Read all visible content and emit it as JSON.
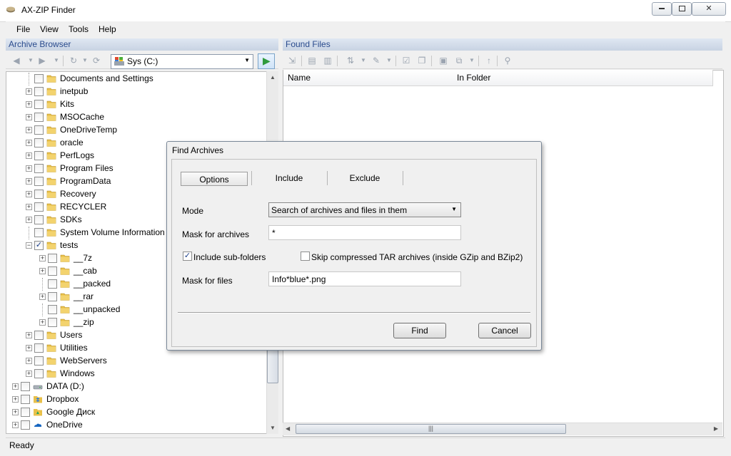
{
  "window": {
    "title": "AX-ZIP Finder",
    "buttons": [
      "▭",
      "□",
      "✕"
    ]
  },
  "menu": [
    "File",
    "View",
    "Tools",
    "Help"
  ],
  "left_pane": {
    "title": "Archive Browser",
    "drive_selected": "Sys (C:)",
    "tree": [
      {
        "label": "Documents and Settings",
        "level": 1,
        "expander": false,
        "checked": false
      },
      {
        "label": "inetpub",
        "level": 1,
        "expander": true,
        "checked": false
      },
      {
        "label": "Kits",
        "level": 1,
        "expander": true,
        "checked": false
      },
      {
        "label": "MSOCache",
        "level": 1,
        "expander": true,
        "checked": false
      },
      {
        "label": "OneDriveTemp",
        "level": 1,
        "expander": true,
        "checked": false
      },
      {
        "label": "oracle",
        "level": 1,
        "expander": true,
        "checked": false
      },
      {
        "label": "PerfLogs",
        "level": 1,
        "expander": true,
        "checked": false
      },
      {
        "label": "Program Files",
        "level": 1,
        "expander": true,
        "checked": false
      },
      {
        "label": "ProgramData",
        "level": 1,
        "expander": true,
        "checked": false
      },
      {
        "label": "Recovery",
        "level": 1,
        "expander": true,
        "checked": false
      },
      {
        "label": "RECYCLER",
        "level": 1,
        "expander": true,
        "checked": false
      },
      {
        "label": "SDKs",
        "level": 1,
        "expander": true,
        "checked": false
      },
      {
        "label": "System Volume Information",
        "level": 1,
        "expander": false,
        "checked": false
      },
      {
        "label": "tests",
        "level": 1,
        "expander": "open",
        "checked": true
      },
      {
        "label": "__7z",
        "level": 2,
        "expander": true,
        "checked": false
      },
      {
        "label": "__cab",
        "level": 2,
        "expander": true,
        "checked": false
      },
      {
        "label": "__packed",
        "level": 2,
        "expander": false,
        "checked": false
      },
      {
        "label": "__rar",
        "level": 2,
        "expander": true,
        "checked": false
      },
      {
        "label": "__unpacked",
        "level": 2,
        "expander": false,
        "checked": false
      },
      {
        "label": "__zip",
        "level": 2,
        "expander": true,
        "checked": false
      },
      {
        "label": "Users",
        "level": 1,
        "expander": true,
        "checked": false
      },
      {
        "label": "Utilities",
        "level": 1,
        "expander": true,
        "checked": false
      },
      {
        "label": "WebServers",
        "level": 1,
        "expander": true,
        "checked": false
      },
      {
        "label": "Windows",
        "level": 1,
        "expander": true,
        "checked": false
      },
      {
        "label": "DATA (D:)",
        "level": 0,
        "expander": true,
        "checked": false,
        "icon": "drive-icon"
      },
      {
        "label": "Dropbox",
        "level": 0,
        "expander": true,
        "checked": false,
        "icon": "dropbox-icon"
      },
      {
        "label": "Google Диск",
        "level": 0,
        "expander": true,
        "checked": false,
        "icon": "google-drive-icon"
      },
      {
        "label": "OneDrive",
        "level": 0,
        "expander": true,
        "checked": false,
        "icon": "onedrive-icon"
      }
    ]
  },
  "right_pane": {
    "title": "Found Files",
    "columns": [
      "Name",
      "In Folder"
    ]
  },
  "status": "Ready",
  "dialog": {
    "title": "Find Archives",
    "tabs": [
      "Options",
      "Include",
      "Exclude"
    ],
    "active_tab": "Options",
    "mode_label": "Mode",
    "mode_value": "Search of archives and files in them",
    "mask_archives_label": "Mask for archives",
    "mask_archives_value": "*",
    "include_subfolders_label": "Include sub-folders",
    "include_subfolders_checked": true,
    "skip_tar_label": "Skip compressed TAR archives (inside GZip and BZip2)",
    "skip_tar_checked": false,
    "mask_files_label": "Mask for files",
    "mask_files_value": "Info*blue*.png",
    "find_button": "Find",
    "cancel_button": "Cancel"
  },
  "colors": {
    "pane_header_text": "#2a4b8d",
    "folder": "#e8c04a",
    "accent_green": "#2e9a3c"
  }
}
